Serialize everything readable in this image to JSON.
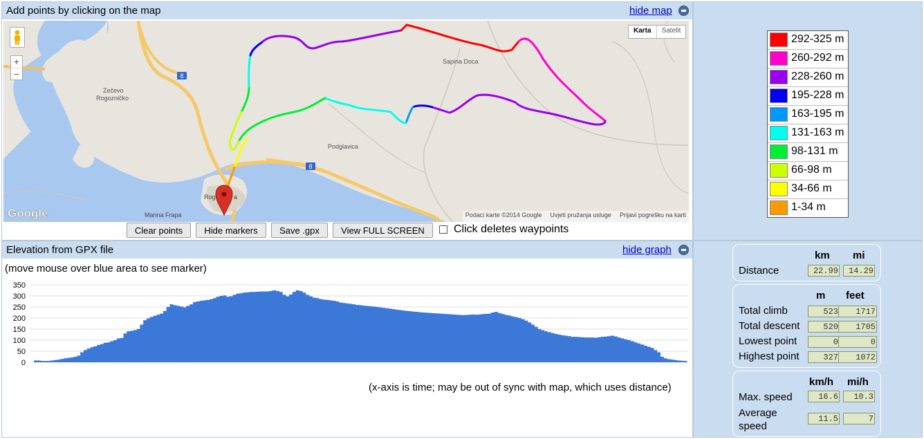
{
  "map_panel": {
    "title": "Add points by clicking on the map",
    "hide_label": "hide map",
    "map_types": [
      "Karta",
      "Satelit"
    ],
    "zoom_in": "+",
    "zoom_out": "−",
    "places": [
      "Sapina Doca",
      "Zečevo",
      "Rogozničko",
      "Podglavica",
      "Rog",
      "a",
      "Marina Frapa"
    ],
    "road_numbers": [
      "8",
      "8"
    ],
    "google_logo": "Google",
    "attribution": [
      "Podaci karte ©2014 Google",
      "Uvjeti pružanja usluge",
      "Prijavi pogrešku na karti"
    ],
    "buttons": [
      "Clear points",
      "Hide markers",
      "Save .gpx",
      "View FULL SCREEN"
    ],
    "checkbox_label": "Click deletes waypoints"
  },
  "legend": [
    {
      "label": "292-325 m",
      "color": "#ff0000"
    },
    {
      "label": "260-292 m",
      "color": "#ff00cc"
    },
    {
      "label": "228-260 m",
      "color": "#9900ee"
    },
    {
      "label": "195-228 m",
      "color": "#0000ee"
    },
    {
      "label": "163-195 m",
      "color": "#0099ff"
    },
    {
      "label": "131-163 m",
      "color": "#00ffee"
    },
    {
      "label": "98-131 m",
      "color": "#00ee33"
    },
    {
      "label": "66-98 m",
      "color": "#ccff00"
    },
    {
      "label": "34-66 m",
      "color": "#ffff00"
    },
    {
      "label": "1-34 m",
      "color": "#ff9900"
    }
  ],
  "graph_panel": {
    "title": "Elevation from GPX file",
    "hide_label": "hide graph",
    "hint": "(move mouse over blue area to see marker)",
    "footnote": "(x-axis is time; may be out of sync with map, which uses distance)"
  },
  "stats": {
    "distance": {
      "headers": [
        "km",
        "mi"
      ],
      "label": "Distance",
      "values": [
        "22.99",
        "14.29"
      ]
    },
    "climb": {
      "headers": [
        "m",
        "feet"
      ],
      "rows": [
        {
          "label": "Total climb",
          "values": [
            "523",
            "1717"
          ]
        },
        {
          "label": "Total descent",
          "values": [
            "520",
            "1705"
          ]
        },
        {
          "label": "Lowest point",
          "values": [
            "0",
            "0"
          ]
        },
        {
          "label": "Highest point",
          "values": [
            "327",
            "1072"
          ]
        }
      ]
    },
    "speed": {
      "headers": [
        "km/h",
        "mi/h"
      ],
      "rows": [
        {
          "label": "Max. speed",
          "values": [
            "16.6",
            "10.3"
          ]
        },
        {
          "label": "Average speed",
          "values": [
            "11.5",
            "7"
          ]
        }
      ]
    }
  },
  "chart_data": {
    "type": "bar",
    "ylim": [
      0,
      350
    ],
    "yticks": [
      0,
      50,
      100,
      150,
      200,
      250,
      300,
      350
    ],
    "values": [
      8,
      8,
      6,
      6,
      6,
      8,
      10,
      12,
      15,
      18,
      20,
      22,
      25,
      30,
      45,
      55,
      62,
      68,
      72,
      78,
      82,
      88,
      90,
      95,
      100,
      108,
      110,
      130,
      140,
      142,
      145,
      150,
      170,
      190,
      198,
      205,
      210,
      215,
      220,
      232,
      250,
      262,
      258,
      255,
      252,
      248,
      255,
      262,
      272,
      275,
      278,
      280,
      282,
      285,
      290,
      296,
      300,
      302,
      296,
      298,
      305,
      310,
      312,
      315,
      316,
      318,
      318,
      319,
      320,
      320,
      320,
      322,
      325,
      322,
      318,
      305,
      298,
      306,
      318,
      325,
      322,
      315,
      305,
      298,
      292,
      290,
      286,
      283,
      282,
      280,
      278,
      275,
      270,
      268,
      266,
      264,
      262,
      259,
      258,
      256,
      255,
      253,
      252,
      250,
      248,
      246,
      244,
      242,
      240,
      238,
      236,
      234,
      232,
      231,
      229,
      228,
      226,
      225,
      224,
      223,
      222,
      221,
      220,
      219,
      218,
      217,
      216,
      215,
      214,
      213,
      214,
      215,
      216,
      215,
      216,
      218,
      219,
      220,
      225,
      228,
      222,
      218,
      214,
      211,
      207,
      204,
      200,
      195,
      188,
      180,
      170,
      160,
      150,
      145,
      140,
      136,
      132,
      128,
      125,
      122,
      120,
      118,
      115,
      115,
      114,
      113,
      112,
      112,
      112,
      111,
      113,
      115,
      116,
      118,
      120,
      117,
      112,
      108,
      104,
      100,
      95,
      90,
      85,
      80,
      75,
      70,
      65,
      55,
      45,
      25,
      18,
      14,
      12,
      10,
      8,
      7,
      6
    ]
  }
}
